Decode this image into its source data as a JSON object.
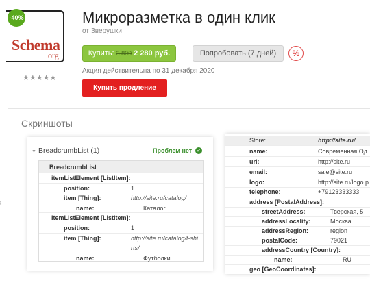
{
  "product": {
    "title": "Микроразметка в один клик",
    "author": "от Зверушки",
    "discount_badge": "-40%",
    "logo_text": "Schema",
    "logo_sub": ".org",
    "rating_stars": "★★★★★",
    "buy_label": "Купить:",
    "old_price": "3 800",
    "new_price": "2 280 руб.",
    "try_label": "Попробовать (7 дней)",
    "percent_symbol": "%",
    "promo_text": "Акция действительна по 31 декабря 2020",
    "renew_label": "Купить продление"
  },
  "screenshots": {
    "title": "Скриншоты",
    "arrow_left": "‹",
    "shot1": {
      "header": "BreadcrumbList (1)",
      "status": "Проблем нет",
      "caption": "BreadcrumbList",
      "rows": [
        {
          "key": "itemListElement [ListItem]:",
          "value": ""
        },
        {
          "key": "position:",
          "value": "1"
        },
        {
          "key": "item [Thing]:",
          "value": "http://site.ru/catalog/"
        },
        {
          "key": "name:",
          "value": "Каталог"
        },
        {
          "key": "itemListElement [ListItem]:",
          "value": ""
        },
        {
          "key": "position:",
          "value": "1"
        },
        {
          "key": "item [Thing]:",
          "value": "http://site.ru/catalog/t-shi"
        },
        {
          "key": "",
          "value": "rts/"
        },
        {
          "key": "name:",
          "value": "Футболки"
        }
      ]
    },
    "shot2": {
      "rows": [
        {
          "key": "Store:",
          "value": "http://site.ru/"
        },
        {
          "key": "name:",
          "value": "Современная Од"
        },
        {
          "key": "url:",
          "value": "http://site.ru"
        },
        {
          "key": "email:",
          "value": "sale@site.ru"
        },
        {
          "key": "logo:",
          "value": "http://site.ru/logo.p"
        },
        {
          "key": "telephone:",
          "value": "+79123333333"
        },
        {
          "key": "address [PostalAddress]:",
          "value": ""
        },
        {
          "key": "streetAddress:",
          "value": "Тверская, 5"
        },
        {
          "key": "addressLocality:",
          "value": "Москва"
        },
        {
          "key": "addressRegion:",
          "value": "region"
        },
        {
          "key": "postalCode:",
          "value": "79021"
        },
        {
          "key": "addressCountry [Country]:",
          "value": ""
        },
        {
          "key": "name:",
          "value": "RU"
        },
        {
          "key": "geo [GeoCoordinates]:",
          "value": ""
        }
      ]
    }
  }
}
